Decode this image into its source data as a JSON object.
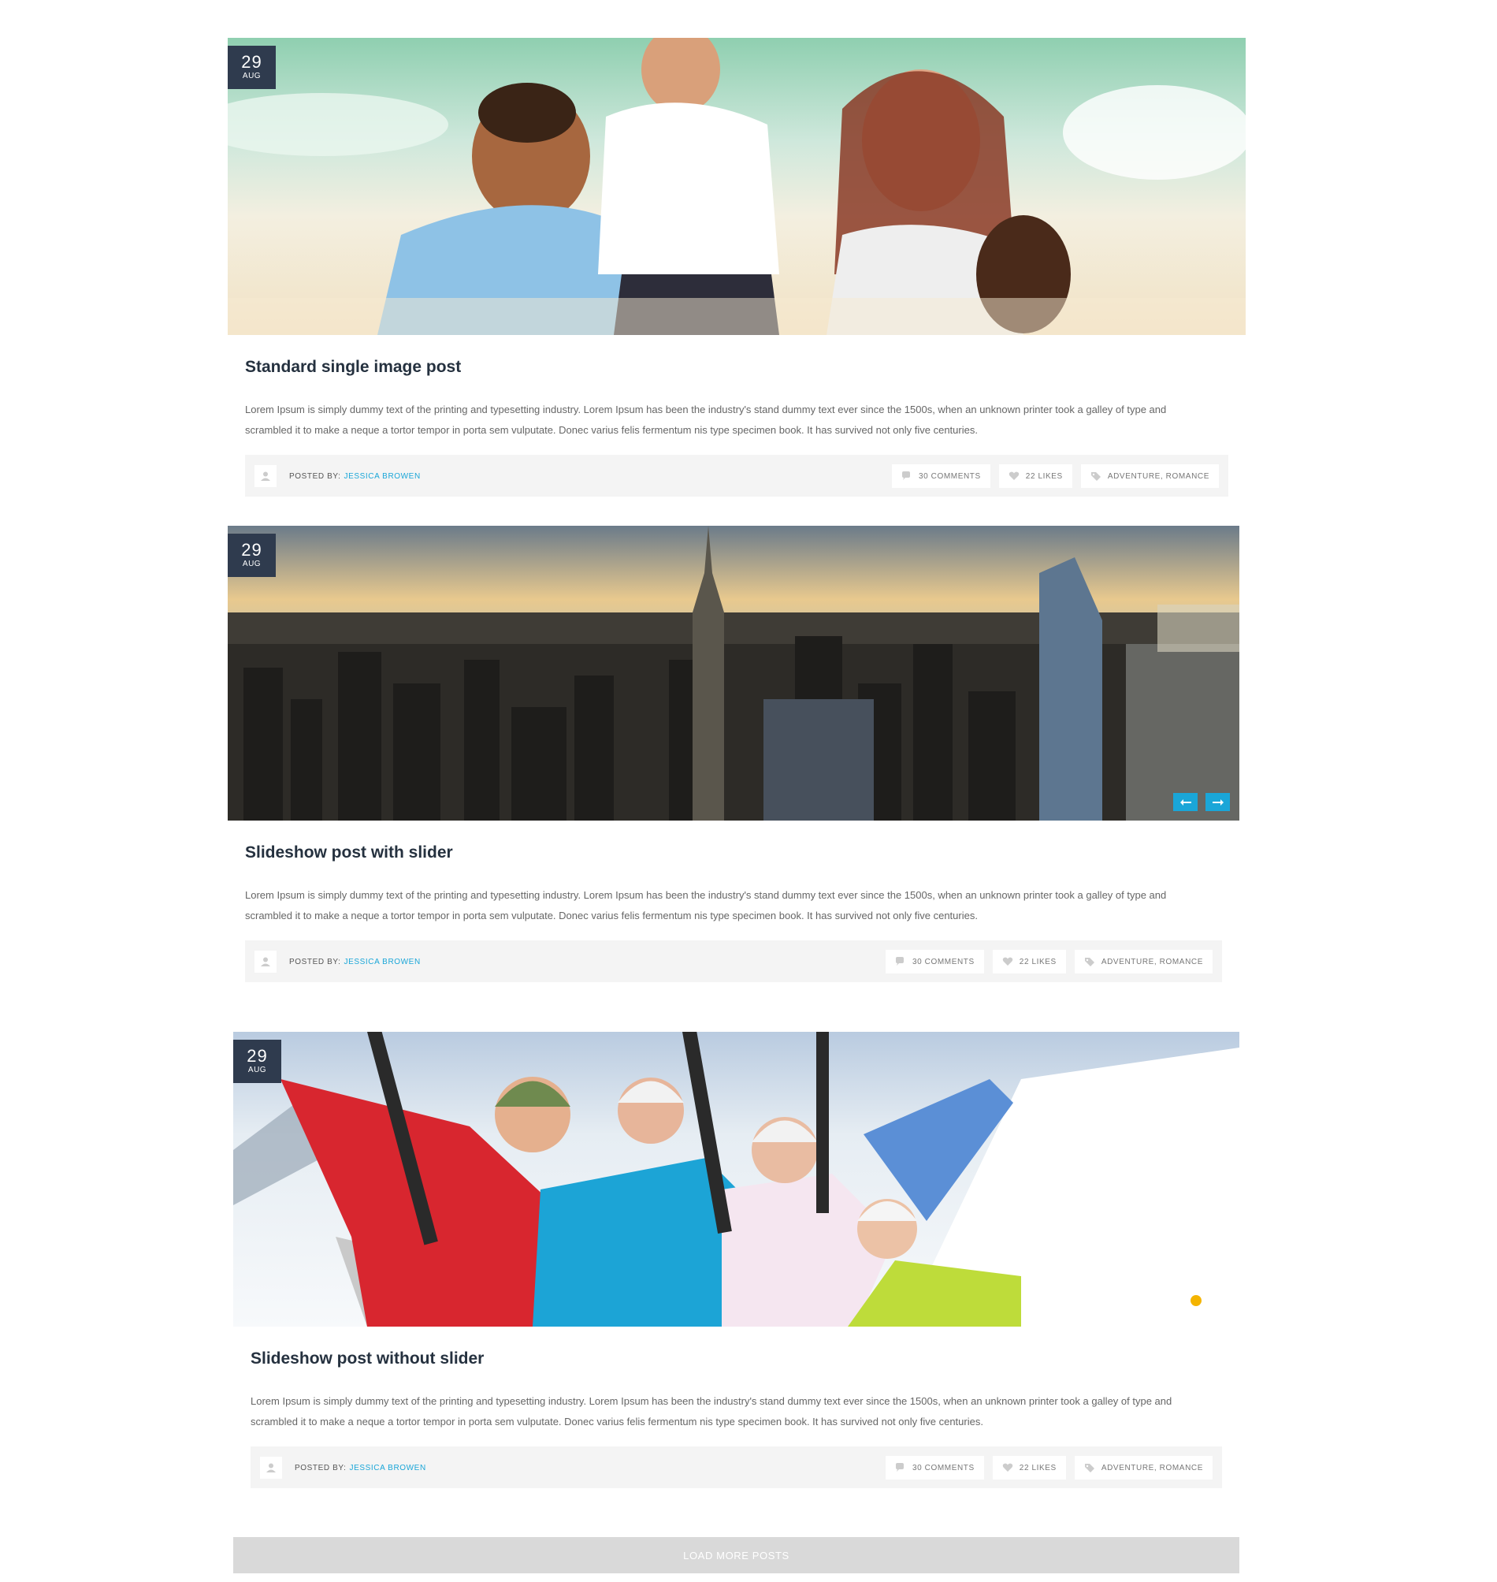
{
  "posts": [
    {
      "date": {
        "day": "29",
        "month": "AUG"
      },
      "title": "Standard single image post",
      "excerpt": "Lorem Ipsum is simply dummy text of the printing and typesetting industry. Lorem Ipsum has been the industry's stand dummy text ever since the 1500s, when an unknown printer took a galley of type and scrambled it to make a neque a tortor tempor in porta sem vulputate. Donec varius felis fermentum nis type specimen book. It has survived not only five centuries.",
      "posted_by_label": "POSTED BY:",
      "author": "JESSICA BROWEN",
      "comments": "30 COMMENTS",
      "likes": "22 LIKES",
      "tags": "ADVENTURE, ROMANCE"
    },
    {
      "date": {
        "day": "29",
        "month": "AUG"
      },
      "title": "Slideshow post with slider",
      "excerpt": "Lorem Ipsum is simply dummy text of the printing and typesetting industry. Lorem Ipsum has been the industry's stand dummy text ever since the 1500s, when an unknown printer took a galley of type and scrambled it to make a neque a tortor tempor in porta sem vulputate. Donec varius felis fermentum nis type specimen book. It has survived not only five centuries.",
      "posted_by_label": "POSTED BY:",
      "author": "JESSICA BROWEN",
      "comments": "30 COMMENTS",
      "likes": "22 LIKES",
      "tags": "ADVENTURE, ROMANCE"
    },
    {
      "date": {
        "day": "29",
        "month": "AUG"
      },
      "title": "Slideshow post without slider",
      "excerpt": "Lorem Ipsum is simply dummy text of the printing and typesetting industry. Lorem Ipsum has been the industry's stand dummy text ever since the 1500s, when an unknown printer took a galley of type and scrambled it to make a neque a tortor tempor in porta sem vulputate. Donec varius felis fermentum nis type specimen book. It has survived not only five centuries.",
      "posted_by_label": "POSTED BY:",
      "author": "JESSICA BROWEN",
      "comments": "30 COMMENTS",
      "likes": "22 LIKES",
      "tags": "ADVENTURE, ROMANCE"
    }
  ],
  "load_more_label": "LOAD MORE POSTS",
  "colors": {
    "accent": "#1aa6d8",
    "badge": "#2f3b4e",
    "dot_active": "#f4b400"
  }
}
